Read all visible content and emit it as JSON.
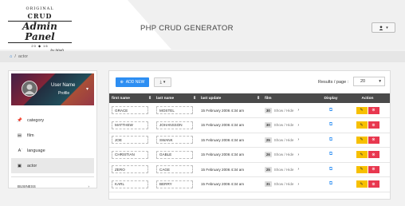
{
  "logo": {
    "line1": "ORIGINAL",
    "line2": "CRUD",
    "line3": "Admin Panel",
    "line4": "20 ◆ 16",
    "line5": "by Migli"
  },
  "app_title": "PHP CRUD GENERATOR",
  "breadcrumb": {
    "current": "actor"
  },
  "sidebar": {
    "profile": {
      "name": "User Name",
      "role": "Profile"
    },
    "items": [
      {
        "label": "category",
        "icon": "pin-icon"
      },
      {
        "label": "film",
        "icon": "film-icon"
      },
      {
        "label": "language",
        "icon": "language-icon"
      },
      {
        "label": "actor",
        "icon": "document-icon",
        "active": true
      }
    ],
    "section": "BUSINESS"
  },
  "toolbar": {
    "add_label": "ADD NEW",
    "rpp_label": "Results / page :",
    "rpp_value": "20"
  },
  "table": {
    "headers": {
      "first_name": "first name",
      "last_name": "last name",
      "last_update": "last update",
      "film": "film",
      "display": "Display",
      "action": "Action"
    },
    "toggle_label": "Show / Hide",
    "rows": [
      {
        "first_name": "GRACE",
        "last_name": "MOSTEL",
        "last_update": "15 February 2006 4:34 am",
        "film_count": "30"
      },
      {
        "first_name": "MATTHEW",
        "last_name": "JOHANSSON",
        "last_update": "15 February 2006 4:34 am",
        "film_count": "30"
      },
      {
        "first_name": "JOE",
        "last_name": "SWANK",
        "last_update": "15 February 2006 4:34 am",
        "film_count": "25"
      },
      {
        "first_name": "CHRISTIAN",
        "last_name": "GABLE",
        "last_update": "15 February 2006 4:34 am",
        "film_count": "26"
      },
      {
        "first_name": "ZERO",
        "last_name": "CAGE",
        "last_update": "15 February 2006 4:34 am",
        "film_count": "25"
      },
      {
        "first_name": "KARL",
        "last_name": "BERRY",
        "last_update": "15 February 2006 4:34 am",
        "film_count": "31"
      }
    ]
  },
  "colors": {
    "primary": "#2d8ef2",
    "edit": "#f7c000",
    "delete": "#e8384f",
    "table_header": "#4a4a4a"
  }
}
